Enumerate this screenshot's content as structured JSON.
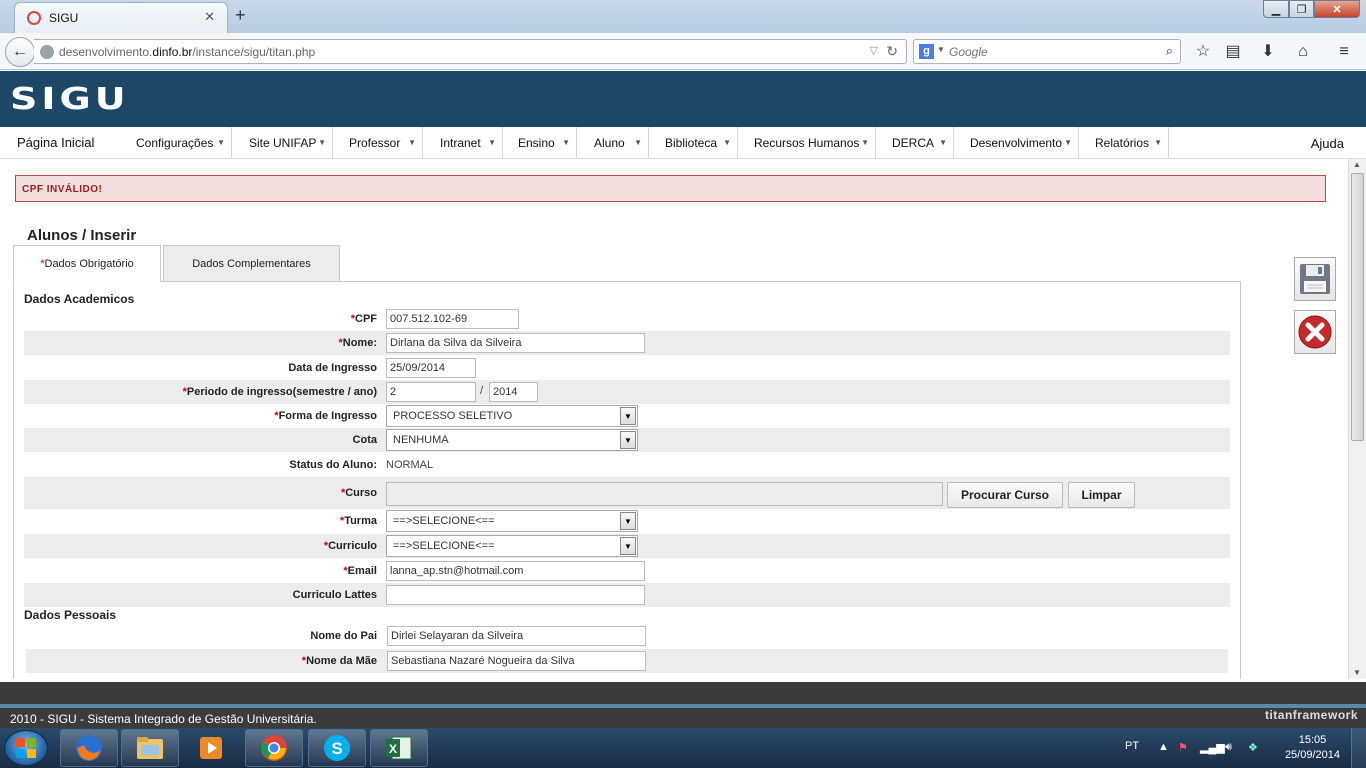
{
  "browser": {
    "tab_title": "SIGU",
    "tab_close": "✕",
    "new_tab": "+",
    "url_prefix": "desenvolvimento.",
    "url_domain": "dinfo.br",
    "url_path": "/instance/sigu/titan.php",
    "search_placeholder": "Google",
    "search_engine_icon": "g"
  },
  "site": {
    "logo": "SIGU"
  },
  "menu": {
    "home": "Página Inicial",
    "items": [
      "Configurações",
      "Site UNIFAP",
      "Professor",
      "Intranet",
      "Ensino",
      "Aluno",
      "Biblioteca",
      "Recursos Humanos",
      "DERCA",
      "Desenvolvimento",
      "Relatórios"
    ],
    "help": "Ajuda"
  },
  "alert": "CPF INVÁLIDO!",
  "page_title": "Alunos / Inserir",
  "tabs": {
    "required_mark": "*",
    "tab1": "Dados Obrigatório",
    "tab2": "Dados Complementares"
  },
  "sections": {
    "academic": "Dados Academicos",
    "personal": "Dados Pessoais"
  },
  "form": {
    "cpf_label": "CPF",
    "cpf_value": "007.512.102-69",
    "nome_label": "Nome:",
    "nome_value": "Dirlana da Silva da Silveira",
    "ingresso_label": "Data de Ingresso",
    "ingresso_value": "25/09/2014",
    "periodo_label": "Periodo de ingresso(semestre / ano)",
    "periodo_semestre": "2",
    "periodo_sep": "/",
    "periodo_ano": "2014",
    "forma_label": "Forma de Ingresso",
    "forma_value": "PROCESSO SELETIVO",
    "cota_label": "Cota",
    "cota_value": "NENHUMA",
    "status_label": "Status do Aluno:",
    "status_value": "NORMAL",
    "curso_label": "Curso",
    "curso_value": "",
    "procurar_button": "Procurar Curso",
    "limpar_button": "Limpar",
    "turma_label": "Turma",
    "turma_value": "==>SELECIONE<==",
    "curriculo_label": "Curriculo",
    "curriculo_value": "==>SELECIONE<==",
    "email_label": "Email",
    "email_value": "lanna_ap.stn@hotmail.com",
    "lattes_label": "Curriculo Lattes",
    "lattes_value": "",
    "pai_label": "Nome do Pai",
    "pai_value": "Dirlei Selayaran da Silveira",
    "mae_label": "Nome da Mãe",
    "mae_value": "Sebastiana Nazaré Nogueira da Silva"
  },
  "footer": {
    "text": "2010 - SIGU - Sistema Integrado de Gestão Universitária.",
    "brand": "titanframework"
  },
  "taskbar": {
    "language": "PT",
    "time": "15:05",
    "date": "25/09/2014"
  },
  "colors": {
    "header_bg": "#1d4766",
    "alert_bg": "#f2dede",
    "alert_text": "#9b1c1c",
    "required": "#cc0000"
  }
}
